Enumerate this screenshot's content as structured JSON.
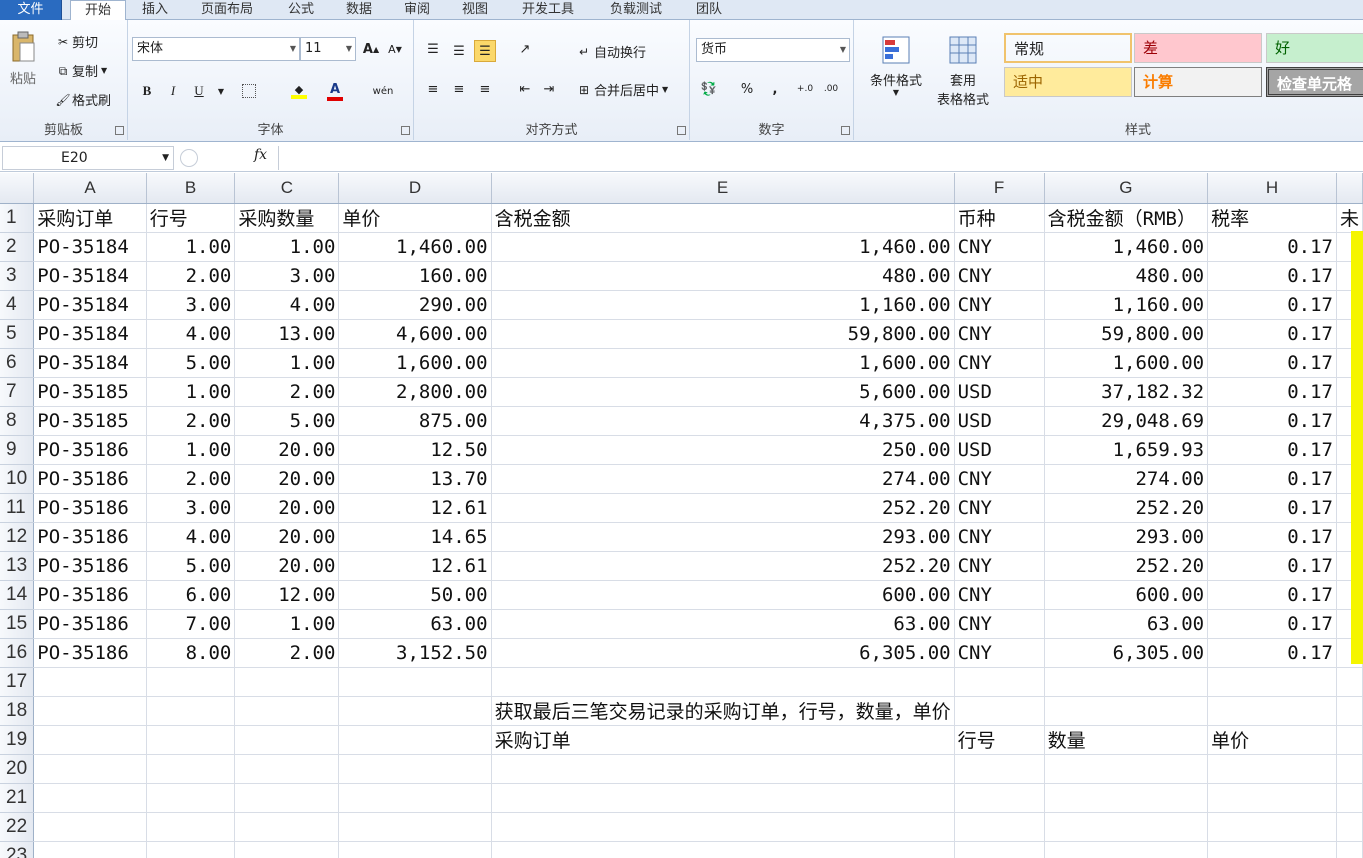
{
  "tabs": [
    "文件",
    "开始",
    "插入",
    "页面布局",
    "公式",
    "数据",
    "审阅",
    "视图",
    "开发工具",
    "负载测试",
    "团队"
  ],
  "ribbon": {
    "clipboard": {
      "paste": "粘贴",
      "cut": "剪切",
      "copy": "复制",
      "format_painter": "格式刷",
      "label": "剪贴板"
    },
    "font": {
      "name": "宋体",
      "size": "11",
      "label": "字体",
      "bold": "B",
      "italic": "I",
      "underline": "U",
      "grow": "A",
      "shrink": "A",
      "wen": "wén",
      "font_color": "A"
    },
    "align": {
      "wrap": "自动换行",
      "merge": "合并后居中",
      "label": "对齐方式"
    },
    "number": {
      "format": "货币",
      "percent": "%",
      "comma": ",",
      "inc": "+.0",
      "dec": ".00",
      "label": "数字"
    },
    "styles": {
      "cond_format": "条件格式",
      "table_format_1": "套用",
      "table_format_2": "表格格式",
      "label": "样式",
      "cells": [
        {
          "text": "常规",
          "bg": "#ffffff",
          "fg": "#111111"
        },
        {
          "text": "差",
          "bg": "#ffc7ce",
          "fg": "#9c0006"
        },
        {
          "text": "好",
          "bg": "#c6efce",
          "fg": "#006100"
        },
        {
          "text": "适中",
          "bg": "#ffeb9c",
          "fg": "#9c6500"
        },
        {
          "text": "计算",
          "bg": "#f2f2f2",
          "fg": "#fa7d00"
        },
        {
          "text": "检查单元格",
          "bg": "#a5a5a5",
          "fg": "#ffffff"
        }
      ]
    }
  },
  "formula_bar": {
    "name_box": "E20",
    "fx": "fx",
    "content": ""
  },
  "sheet": {
    "columns": [
      "A",
      "B",
      "C",
      "D",
      "E",
      "F",
      "G",
      "H"
    ],
    "row_numbers": [
      "1",
      "2",
      "3",
      "4",
      "5",
      "6",
      "7",
      "8",
      "9",
      "10",
      "11",
      "12",
      "13",
      "14",
      "15",
      "16",
      "17",
      "18",
      "19",
      "20",
      "21",
      "22",
      "23"
    ],
    "headers": [
      "采购订单",
      "行号",
      "采购数量",
      "单价",
      "含税金额",
      "币种",
      "含税金额（RMB）",
      "税率"
    ],
    "i_overflow": "未",
    "rows": [
      [
        "PO-35184",
        "1.00",
        "1.00",
        "1,460.00",
        "1,460.00",
        "CNY",
        "1,460.00",
        "0.17"
      ],
      [
        "PO-35184",
        "2.00",
        "3.00",
        "160.00",
        "480.00",
        "CNY",
        "480.00",
        "0.17"
      ],
      [
        "PO-35184",
        "3.00",
        "4.00",
        "290.00",
        "1,160.00",
        "CNY",
        "1,160.00",
        "0.17"
      ],
      [
        "PO-35184",
        "4.00",
        "13.00",
        "4,600.00",
        "59,800.00",
        "CNY",
        "59,800.00",
        "0.17"
      ],
      [
        "PO-35184",
        "5.00",
        "1.00",
        "1,600.00",
        "1,600.00",
        "CNY",
        "1,600.00",
        "0.17"
      ],
      [
        "PO-35185",
        "1.00",
        "2.00",
        "2,800.00",
        "5,600.00",
        "USD",
        "37,182.32",
        "0.17"
      ],
      [
        "PO-35185",
        "2.00",
        "5.00",
        "875.00",
        "4,375.00",
        "USD",
        "29,048.69",
        "0.17"
      ],
      [
        "PO-35186",
        "1.00",
        "20.00",
        "12.50",
        "250.00",
        "USD",
        "1,659.93",
        "0.17"
      ],
      [
        "PO-35186",
        "2.00",
        "20.00",
        "13.70",
        "274.00",
        "CNY",
        "274.00",
        "0.17"
      ],
      [
        "PO-35186",
        "3.00",
        "20.00",
        "12.61",
        "252.20",
        "CNY",
        "252.20",
        "0.17"
      ],
      [
        "PO-35186",
        "4.00",
        "20.00",
        "14.65",
        "293.00",
        "CNY",
        "293.00",
        "0.17"
      ],
      [
        "PO-35186",
        "5.00",
        "20.00",
        "12.61",
        "252.20",
        "CNY",
        "252.20",
        "0.17"
      ],
      [
        "PO-35186",
        "6.00",
        "12.00",
        "50.00",
        "600.00",
        "CNY",
        "600.00",
        "0.17"
      ],
      [
        "PO-35186",
        "7.00",
        "1.00",
        "63.00",
        "63.00",
        "CNY",
        "63.00",
        "0.17"
      ],
      [
        "PO-35186",
        "8.00",
        "2.00",
        "3,152.50",
        "6,305.00",
        "CNY",
        "6,305.00",
        "0.17"
      ]
    ],
    "note": "获取最后三笔交易记录的采购订单，行号，数量，单价",
    "sub_headers": [
      "采购订单",
      "行号",
      "数量",
      "单价"
    ]
  }
}
